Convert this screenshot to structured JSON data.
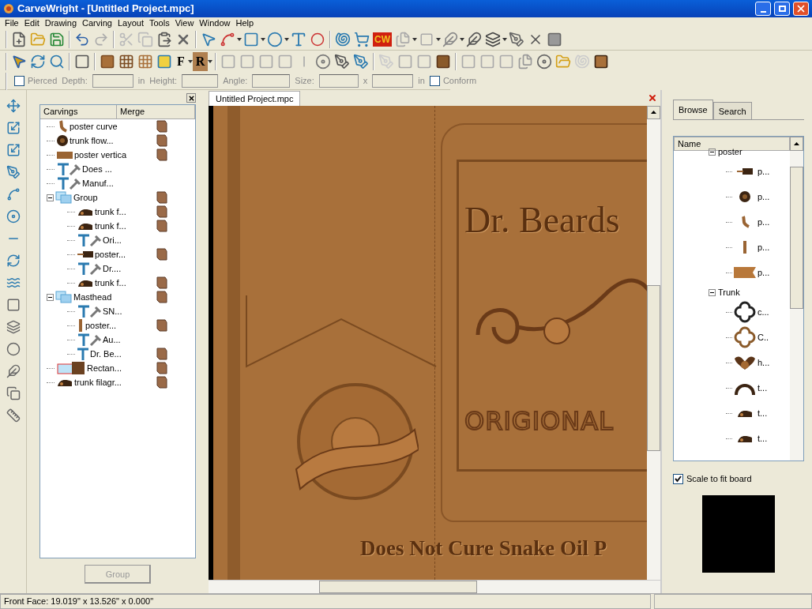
{
  "window": {
    "title": "CarveWright - [Untitled Project.mpc]"
  },
  "menu": [
    "File",
    "Edit",
    "Drawing",
    "Carving",
    "Layout",
    "Tools",
    "View",
    "Window",
    "Help"
  ],
  "toolbar": {
    "cw_logo": "CW",
    "front_letter": "F",
    "rear_letter": "R"
  },
  "options_bar": {
    "pierced": {
      "label": "Pierced",
      "checked": false
    },
    "depth_label": "Depth:",
    "depth_unit": "in",
    "height_label": "Height:",
    "angle_label": "Angle:",
    "size_label": "Size:",
    "size_sep": "x",
    "size_unit": "in",
    "conform": {
      "label": "Conform",
      "checked": false
    }
  },
  "carvings_panel": {
    "columns": [
      "Carvings",
      "Merge"
    ],
    "button": "Group",
    "items": [
      {
        "kind": "curve",
        "label": "poster curve",
        "merge": true
      },
      {
        "kind": "round",
        "label": "trunk flow...",
        "merge": true
      },
      {
        "kind": "bar",
        "label": "poster vertica",
        "merge": true
      },
      {
        "kind": "text",
        "label": "Does ...",
        "merge": false
      },
      {
        "kind": "text",
        "label": "Manuf...",
        "merge": false
      },
      {
        "kind": "group",
        "label": "Group",
        "merge": true,
        "expanded": true,
        "children": [
          {
            "kind": "ornament",
            "label": "trunk f...",
            "merge": true
          },
          {
            "kind": "ornament",
            "label": "trunk f...",
            "merge": true
          },
          {
            "kind": "text",
            "label": "Ori...",
            "merge": false
          },
          {
            "kind": "tab",
            "label": "poster...",
            "merge": true
          },
          {
            "kind": "text",
            "label": "Dr....",
            "merge": false
          },
          {
            "kind": "ornament",
            "label": "trunk f...",
            "merge": true
          }
        ]
      },
      {
        "kind": "group",
        "label": "Masthead",
        "merge": true,
        "expanded": true,
        "children": [
          {
            "kind": "text",
            "label": "SN...",
            "merge": false
          },
          {
            "kind": "post",
            "label": "poster...",
            "merge": true
          },
          {
            "kind": "text",
            "label": "Au...",
            "merge": false
          },
          {
            "kind": "plaintext",
            "label": "Dr. Be...",
            "merge": true
          }
        ]
      },
      {
        "kind": "rectangle",
        "label": "Rectan...",
        "merge": true
      },
      {
        "kind": "ornament",
        "label": "trunk filagr...",
        "merge": true
      }
    ]
  },
  "document_tab": {
    "label": "Untitled Project.mpc",
    "selected": true
  },
  "canvas": {
    "headline": "Dr. Beards",
    "subtitle": "ORIGIONAL",
    "footer_text": "Does Not Cure Snake Oil P"
  },
  "library_panel": {
    "tabs": [
      {
        "label": "Browse",
        "selected": true
      },
      {
        "label": "Search",
        "selected": false
      }
    ],
    "column": "Name",
    "folders": [
      {
        "label": "poster",
        "expanded": true,
        "children": [
          {
            "kind": "tab",
            "label": "p..."
          },
          {
            "kind": "round",
            "label": "p..."
          },
          {
            "kind": "curve",
            "label": "p..."
          },
          {
            "kind": "post",
            "label": "p..."
          },
          {
            "kind": "banner",
            "label": "p..."
          }
        ]
      },
      {
        "label": "Trunk",
        "expanded": true,
        "children": [
          {
            "kind": "quatrefoil",
            "label": "c..."
          },
          {
            "kind": "quatrefoil-light",
            "label": "C.."
          },
          {
            "kind": "shell",
            "label": "h..."
          },
          {
            "kind": "arch",
            "label": "t..."
          },
          {
            "kind": "ornament",
            "label": "t..."
          },
          {
            "kind": "ornament",
            "label": "t..."
          }
        ]
      }
    ],
    "scale_to_fit": {
      "label": "Scale to fit board",
      "checked": true
    }
  },
  "status_bar": "Front Face: 19.019\" x 13.526\" x 0.000\""
}
